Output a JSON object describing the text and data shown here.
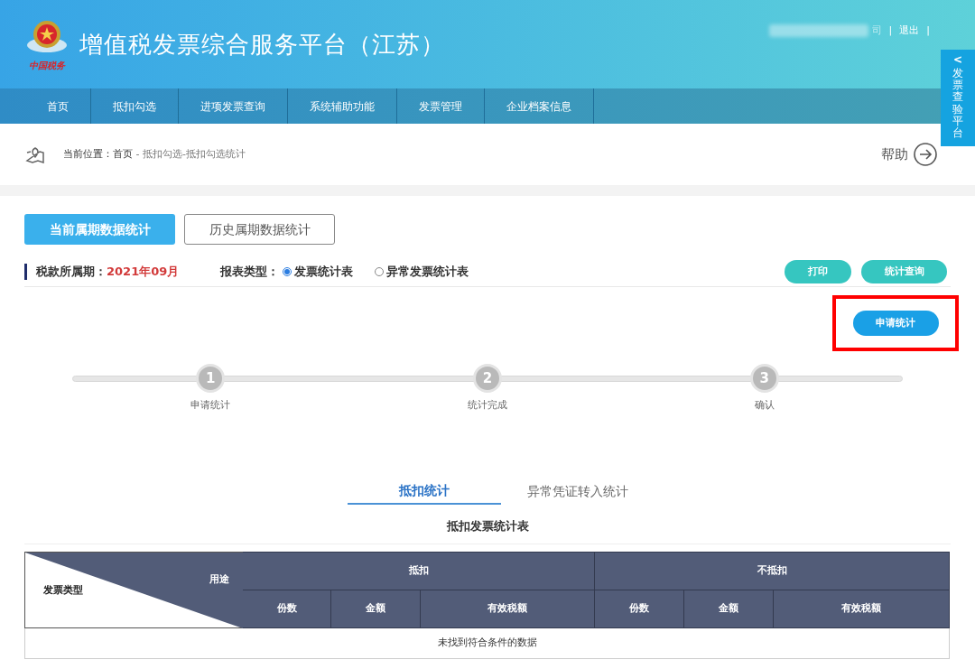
{
  "header": {
    "title": "增值税发票综合服务平台（江苏）",
    "logo_text": "中国税务",
    "user_suffix": "司",
    "separator": "|",
    "logout": "退出"
  },
  "nav": [
    {
      "label": "首页",
      "selected": false
    },
    {
      "label": "抵扣勾选",
      "selected": false
    },
    {
      "label": "进项发票查询",
      "selected": false
    },
    {
      "label": "系统辅助功能",
      "selected": false
    },
    {
      "label": "发票管理",
      "selected": false
    },
    {
      "label": "企业档案信息",
      "selected": false
    }
  ],
  "side_tab": {
    "arrow": "<",
    "label": "发票查验平台"
  },
  "breadcrumb": {
    "prefix": "当前位置：",
    "home": "首页",
    "path": " - 抵扣勾选-抵扣勾选统计"
  },
  "help": "帮助",
  "period_tabs": [
    {
      "label": "当前属期数据统计",
      "selected": true
    },
    {
      "label": "历史属期数据统计",
      "selected": false
    }
  ],
  "filters": {
    "period_label": "税款所属期：",
    "period_value": "2021年09月",
    "type_label": "报表类型：",
    "types": [
      {
        "label": "发票统计表",
        "selected": true
      },
      {
        "label": "异常发票统计表",
        "selected": false
      }
    ]
  },
  "actions": [
    {
      "label": "打印"
    },
    {
      "label": "统计查询"
    }
  ],
  "apply_button": {
    "label": "申请统计",
    "highlighted": true
  },
  "steps": [
    {
      "number": "1",
      "label": "申请统计"
    },
    {
      "number": "2",
      "label": "统计完成"
    },
    {
      "number": "3",
      "label": "确认"
    }
  ],
  "sub_tabs": [
    {
      "label": "抵扣统计",
      "selected": true
    },
    {
      "label": "异常凭证转入统计",
      "selected": false
    }
  ],
  "table": {
    "title": "抵扣发票统计表",
    "corner_top": "用途",
    "corner_bottom": "发票类型",
    "groups": [
      {
        "label": "抵扣",
        "columns": [
          "份数",
          "金额",
          "有效税额"
        ]
      },
      {
        "label": "不抵扣",
        "columns": [
          "份数",
          "金额",
          "有效税额"
        ]
      }
    ],
    "empty_message": "未找到符合条件的数据"
  }
}
